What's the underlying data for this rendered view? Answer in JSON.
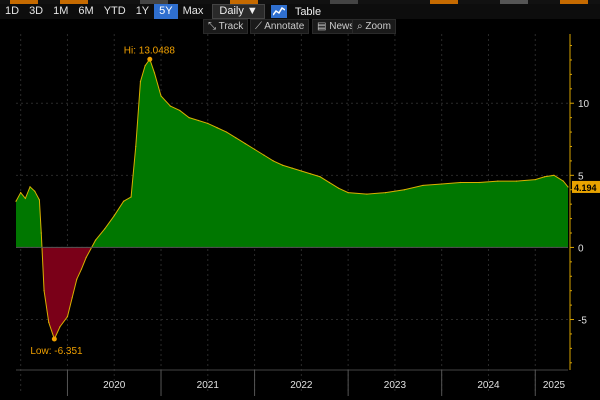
{
  "toolbar": {
    "ranges": [
      "1D",
      "3D",
      "1M",
      "6M",
      "YTD",
      "1Y",
      "5Y",
      "Max"
    ],
    "active_range": "5Y",
    "frequency": "Daily ▼",
    "table_label": "Table"
  },
  "toolbar2": {
    "track": "⤡ Track",
    "annotate": "⟋ Annotate",
    "news": "▤ News",
    "zoom": "⌕ Zoom"
  },
  "colors": {
    "positive": "#007700",
    "negative": "#7a0018",
    "axis": "#d9a400",
    "annotation": "#f0a000",
    "accent": "#2f6fcf"
  },
  "chart_data": {
    "type": "area",
    "xlabel": "",
    "ylabel": "",
    "x_ticks": [
      "2020",
      "2021",
      "2022",
      "2023",
      "2024",
      "2025"
    ],
    "y_ticks": [
      -5,
      0,
      5,
      10
    ],
    "ylim": [
      -8.5,
      14.8
    ],
    "xlim": [
      2019.45,
      2025.35
    ],
    "grid": true,
    "last_value": "4.194",
    "hi_label": "Hi: 13.0488",
    "low_label": "Low: -6.351",
    "hi": {
      "x": 2020.88,
      "y": 13.0488
    },
    "low": {
      "x": 2019.86,
      "y": -6.351
    },
    "series": [
      {
        "x": [
          2019.45,
          2019.5,
          2019.55,
          2019.6,
          2019.65,
          2019.7,
          2019.72,
          2019.75,
          2019.8,
          2019.86,
          2019.92,
          2020.0,
          2020.05,
          2020.1,
          2020.15,
          2020.2,
          2020.3,
          2020.4,
          2020.5,
          2020.6,
          2020.68,
          2020.73,
          2020.78,
          2020.83,
          2020.88,
          2020.93,
          2021.0,
          2021.1,
          2021.2,
          2021.3,
          2021.4,
          2021.5,
          2021.6,
          2021.7,
          2021.8,
          2021.9,
          2022.0,
          2022.1,
          2022.2,
          2022.3,
          2022.4,
          2022.5,
          2022.6,
          2022.7,
          2022.8,
          2022.9,
          2023.0,
          2023.2,
          2023.4,
          2023.6,
          2023.8,
          2024.0,
          2024.2,
          2024.4,
          2024.6,
          2024.8,
          2025.0,
          2025.1,
          2025.2,
          2025.3,
          2025.35
        ],
        "values": [
          3.2,
          3.8,
          3.4,
          4.2,
          3.9,
          3.3,
          1.0,
          -3.0,
          -5.2,
          -6.351,
          -5.5,
          -4.8,
          -3.5,
          -2.2,
          -1.5,
          -0.7,
          0.5,
          1.3,
          2.2,
          3.2,
          3.5,
          7.0,
          11.5,
          12.6,
          13.0488,
          12.1,
          10.5,
          9.8,
          9.5,
          9.0,
          8.8,
          8.6,
          8.3,
          8.0,
          7.6,
          7.2,
          6.8,
          6.4,
          6.0,
          5.7,
          5.5,
          5.3,
          5.1,
          4.9,
          4.5,
          4.1,
          3.8,
          3.7,
          3.8,
          4.0,
          4.3,
          4.4,
          4.5,
          4.5,
          4.6,
          4.6,
          4.7,
          4.9,
          5.0,
          4.6,
          4.194
        ]
      }
    ]
  }
}
